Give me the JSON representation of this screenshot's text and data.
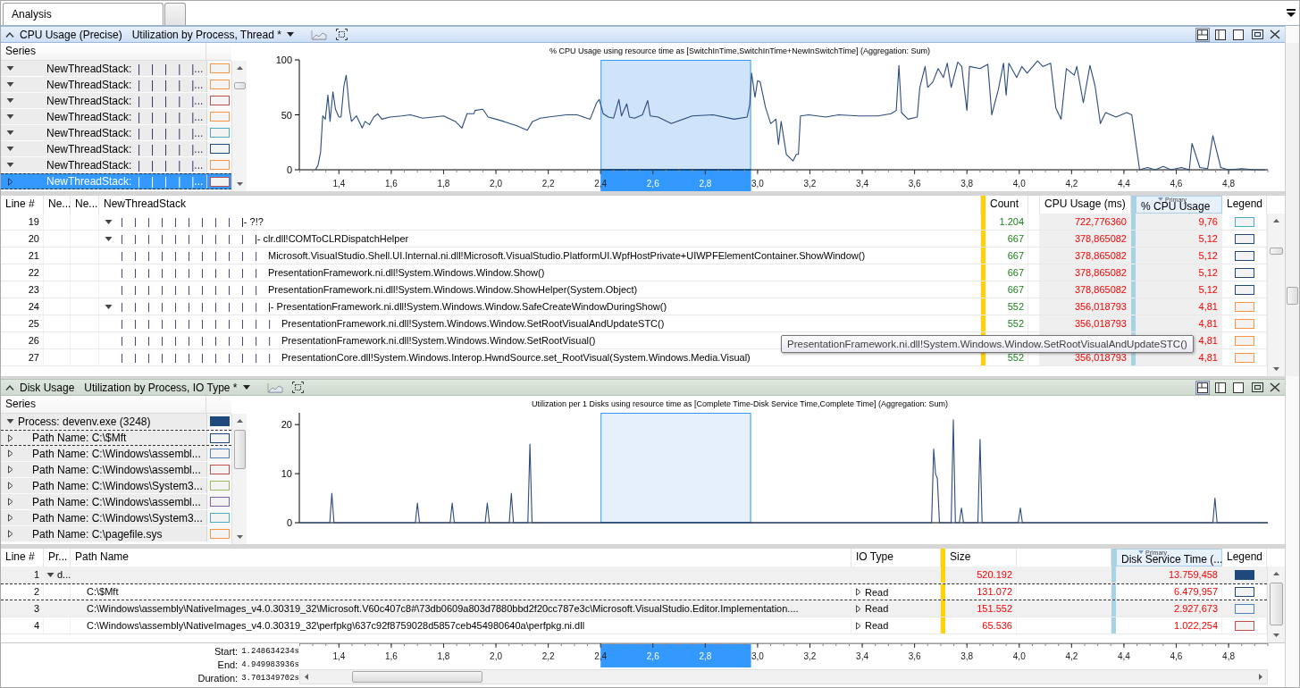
{
  "tabs": [
    {
      "label": "Analysis",
      "selected": true
    },
    {
      "selected": false
    }
  ],
  "panels": [
    {
      "kind": "cpu",
      "active": true,
      "title": "CPU Usage (Precise)",
      "preset": "Utilization by Process, Thread *",
      "view_modes": [
        {
          "kind": "split",
          "selected": true
        },
        {
          "kind": "table",
          "selected": false
        },
        {
          "kind": "graph",
          "selected": false
        }
      ],
      "series_header": "Series",
      "series": [
        {
          "label": "NewThreadStack:",
          "tree": "| | | | |...",
          "expanded": true,
          "selected": false,
          "focused": false,
          "filled": false,
          "color": "#f79646"
        },
        {
          "label": "NewThreadStack:",
          "tree": "| | | | |...",
          "expanded": true,
          "selected": false,
          "focused": false,
          "filled": false,
          "color": "#f79646"
        },
        {
          "label": "NewThreadStack:",
          "tree": "| | | | |...",
          "expanded": true,
          "selected": false,
          "focused": false,
          "filled": false,
          "color": "#c0504d"
        },
        {
          "label": "NewThreadStack:",
          "tree": "| | | | |...",
          "expanded": true,
          "selected": false,
          "focused": false,
          "filled": false,
          "color": "#f79646"
        },
        {
          "label": "NewThreadStack:",
          "tree": "| | | | |...",
          "expanded": true,
          "selected": false,
          "focused": false,
          "filled": false,
          "color": "#4bacc6"
        },
        {
          "label": "NewThreadStack:",
          "tree": "| | | | |...",
          "expanded": true,
          "selected": false,
          "focused": false,
          "filled": false,
          "color": "#1f497d"
        },
        {
          "label": "NewThreadStack:",
          "tree": "| | | | |...",
          "expanded": true,
          "selected": false,
          "focused": false,
          "filled": false,
          "color": "#f79646"
        },
        {
          "label": "NewThreadStack:",
          "tree": "| | | | |...",
          "expanded": false,
          "selected": true,
          "focused": true,
          "filled": false,
          "color": "#c0504d"
        }
      ],
      "chart_data": {
        "type": "line",
        "title": "% CPU Usage using resource time as [SwitchInTime,SwitchInTime+NewInSwitchTime] (Aggregation: Sum)",
        "x": [
          1.31,
          1.32,
          1.33,
          1.338,
          1.348,
          1.358,
          1.366,
          1.377,
          1.387,
          1.4,
          1.408,
          1.419,
          1.428,
          1.44,
          1.448,
          1.467,
          1.489,
          1.5,
          1.517,
          1.533,
          1.548,
          1.564,
          1.595,
          1.64,
          1.673,
          1.72,
          1.8,
          1.845,
          1.87,
          1.89,
          1.916,
          1.92,
          1.95,
          1.97,
          2.0,
          2.03,
          2.08,
          2.12,
          2.14,
          2.17,
          2.2,
          2.27,
          2.31,
          2.36,
          2.385,
          2.395,
          2.41,
          2.43,
          2.45,
          2.47,
          2.48,
          2.5,
          2.51,
          2.53,
          2.56,
          2.58,
          2.59,
          2.62,
          2.67,
          2.75,
          2.83,
          2.91,
          2.96,
          2.97,
          2.977,
          2.99,
          3.0,
          3.01,
          3.03,
          3.05,
          3.07,
          3.08,
          3.09,
          3.11,
          3.135,
          3.148,
          3.156,
          3.164,
          3.196,
          3.26,
          3.31,
          3.385,
          3.46,
          3.51,
          3.53,
          3.54,
          3.55,
          3.575,
          3.61,
          3.62,
          3.64,
          3.65,
          3.67,
          3.69,
          3.71,
          3.725,
          3.74,
          3.765,
          3.78,
          3.8,
          3.81,
          3.85,
          3.88,
          3.895,
          3.92,
          3.94,
          3.95,
          3.96,
          3.99,
          4.01,
          4.03,
          4.07,
          4.09,
          4.12,
          4.14,
          4.16,
          4.18,
          4.21,
          4.22,
          4.245,
          4.27,
          4.29,
          4.31,
          4.33,
          4.37,
          4.41,
          4.43,
          4.46,
          4.49,
          4.52,
          4.55,
          4.58,
          4.62,
          4.65,
          4.66,
          4.69,
          4.72,
          4.74,
          4.77,
          4.8,
          4.85,
          4.9,
          4.94
        ],
        "series": [
          {
            "color": "#2b4c7e",
            "values": [
              0,
              4,
              16,
              49,
              46,
              68,
              44,
              71,
              55,
              48,
              48,
              76,
              86,
              55,
              44,
              49,
              38,
              44,
              41,
              48,
              51,
              46,
              48,
              49,
              50,
              47,
              49,
              44,
              38,
              51,
              51,
              54,
              55,
              48,
              46,
              44,
              40,
              36,
              44,
              47,
              48,
              50,
              50,
              46,
              61,
              64,
              51,
              48,
              47,
              64,
              49,
              60,
              48,
              47,
              50,
              63,
              49,
              48,
              42,
              49,
              50,
              46,
              48,
              59,
              88,
              66,
              81,
              80,
              57,
              42,
              46,
              23,
              44,
              14,
              8,
              14,
              14,
              49,
              50,
              48,
              50,
              49,
              49,
              51,
              54,
              95,
              52,
              46,
              48,
              75,
              94,
              75,
              80,
              92,
              84,
              97,
              75,
              98,
              94,
              54,
              94,
              92,
              96,
              50,
              73,
              97,
              68,
              97,
              84,
              94,
              88,
              99,
              94,
              97,
              56,
              46,
              92,
              86,
              94,
              61,
              95,
              76,
              42,
              52,
              48,
              52,
              50,
              0,
              2,
              0,
              3,
              0,
              2,
              0,
              24,
              2,
              1,
              31,
              2,
              0,
              1,
              0,
              0
            ]
          }
        ],
        "xlim": [
          1.2486,
          4.95
        ],
        "ylim": [
          0,
          100
        ],
        "xticks": [
          {
            "value": 1.4,
            "label": "1,4"
          },
          {
            "value": 1.6,
            "label": "1,6"
          },
          {
            "value": 1.8,
            "label": "1,8"
          },
          {
            "value": 2.0,
            "label": "2,0"
          },
          {
            "value": 2.2,
            "label": "2,2"
          },
          {
            "value": 2.4,
            "label": "2,4"
          },
          {
            "value": 2.6,
            "label": "2,6"
          },
          {
            "value": 2.8,
            "label": "2,8"
          },
          {
            "value": 3.0,
            "label": "3,0"
          },
          {
            "value": 3.2,
            "label": "3,2"
          },
          {
            "value": 3.4,
            "label": "3,4"
          },
          {
            "value": 3.6,
            "label": "3,6"
          },
          {
            "value": 3.8,
            "label": "3,8"
          },
          {
            "value": 4.0,
            "label": "4,0"
          },
          {
            "value": 4.2,
            "label": "4,2"
          },
          {
            "value": 4.4,
            "label": "4,4"
          },
          {
            "value": 4.6,
            "label": "4,6"
          },
          {
            "value": 4.8,
            "label": "4,8"
          }
        ],
        "yticks": [
          0,
          50,
          100
        ],
        "bands": [
          {
            "axis": "x",
            "from": 2.4,
            "to": 2.975
          }
        ]
      },
      "table": {
        "columns": [
          {
            "kind": "text",
            "label": "Line #",
            "sorted": false
          },
          {
            "kind": "text",
            "label": "Ne...",
            "sorted": false
          },
          {
            "kind": "text",
            "label": "Ne...",
            "sorted": false
          },
          {
            "kind": "text",
            "label": "NewThreadStack",
            "sorted": false
          },
          {
            "kind": "divider",
            "color": "#ffd200"
          },
          {
            "kind": "text",
            "label": "Count",
            "sorted": false
          },
          {
            "kind": "blank"
          },
          {
            "kind": "text",
            "label": "CPU Usage (ms)",
            "sorted": false
          },
          {
            "kind": "divider",
            "color": "#a9d3e5"
          },
          {
            "kind": "text",
            "label": "% CPU Usage",
            "badge": "Primary",
            "sorted": true
          },
          {
            "kind": "text",
            "label": "Legend",
            "sorted": false
          }
        ],
        "rows": [
          {
            "line": "19",
            "kind": "branch",
            "expanded": true,
            "tree": "| | | | | | | | |",
            "name": "|- ?!?",
            "count": "1.204",
            "cpu": "722,776360",
            "percent": "9,76",
            "color": "#4bacc6"
          },
          {
            "line": "20",
            "kind": "branch",
            "expanded": true,
            "tree": "| | | | | | | | | |",
            "name": "|- clr.dll!COMToCLRDispatchHelper",
            "count": "667",
            "cpu": "378,865082",
            "percent": "5,12",
            "color": "#1f497d"
          },
          {
            "line": "21",
            "kind": "leaf",
            "tree": "| | | | | | | | | | |",
            "name": "Microsoft.VisualStudio.Shell.UI.Internal.ni.dll!Microsoft.VisualStudio.PlatformUI.WpfHostPrivate+UIWPFElementContainer.ShowWindow()",
            "count": "667",
            "cpu": "378,865082",
            "percent": "5,12",
            "color": "#1f497d"
          },
          {
            "line": "22",
            "kind": "leaf",
            "tree": "| | | | | | | | | | |",
            "name": "PresentationFramework.ni.dll!System.Windows.Window.Show()",
            "count": "667",
            "cpu": "378,865082",
            "percent": "5,12",
            "color": "#1f497d"
          },
          {
            "line": "23",
            "kind": "leaf",
            "tree": "| | | | | | | | | | |",
            "name": "PresentationFramework.ni.dll!System.Windows.Window.ShowHelper(System.Object)",
            "count": "667",
            "cpu": "378,865082",
            "percent": "5,12",
            "color": "#1f497d"
          },
          {
            "line": "24",
            "kind": "branch",
            "expanded": true,
            "tree": "| | | | | | | | | | |",
            "name": "|- PresentationFramework.ni.dll!System.Windows.Window.SafeCreateWindowDuringShow()",
            "count": "552",
            "cpu": "356,018793",
            "percent": "4,81",
            "color": "#f79646"
          },
          {
            "line": "25",
            "kind": "leaf",
            "tree": "| | | | | | | | | | | |",
            "name": "PresentationFramework.ni.dll!System.Windows.Window.SetRootVisualAndUpdateSTC()",
            "count": "552",
            "cpu": "356,018793",
            "percent": "4,81",
            "color": "#f79646"
          },
          {
            "line": "26",
            "kind": "leaf",
            "tree": "| | | | | | | | | | | |",
            "name": "PresentationFramework.ni.dll!System.Windows.Window.SetRootVisual()",
            "percent": "4,81",
            "color": "#f79646"
          },
          {
            "line": "27",
            "kind": "leaf",
            "tree": "| | | | | | | | | | | |",
            "name": "PresentationCore.dll!System.Windows.Interop.HwndSource.set_RootVisual(System.Windows.Media.Visual)",
            "count": "552",
            "cpu": "356,018793",
            "percent": "4,81",
            "color": "#f79646"
          }
        ]
      },
      "tooltip": "PresentationFramework.ni.dll!System.Windows.Window.SetRootVisualAndUpdateSTC()"
    },
    {
      "kind": "disk",
      "active": false,
      "title": "Disk Usage",
      "preset": "Utilization by Process, IO Type *",
      "view_modes": [
        {
          "kind": "split",
          "selected": true
        },
        {
          "kind": "table",
          "selected": false
        },
        {
          "kind": "graph",
          "selected": false
        }
      ],
      "series_header": "Series",
      "series": [
        {
          "label": "Process: devenv.exe (3248)",
          "expanded": true,
          "selected": false,
          "focused": false,
          "filled": true,
          "color": "#1f497d",
          "children": [
            {
              "label": "Path Name: C:\\$Mft",
              "expanded": false,
              "selected": false,
              "focused": true,
              "filled": false,
              "color": "#1f497d"
            },
            {
              "label": "Path Name: C:\\Windows\\assembl...",
              "expanded": false,
              "selected": false,
              "focused": false,
              "filled": false,
              "color": "#4f81bd"
            },
            {
              "label": "Path Name: C:\\Windows\\assembl...",
              "expanded": false,
              "selected": false,
              "focused": false,
              "filled": false,
              "color": "#c0504d"
            },
            {
              "label": "Path Name: C:\\Windows\\System3...",
              "expanded": false,
              "selected": false,
              "focused": false,
              "filled": false,
              "color": "#9bbb59"
            },
            {
              "label": "Path Name: C:\\Windows\\assembl...",
              "expanded": false,
              "selected": false,
              "focused": false,
              "filled": false,
              "color": "#8064a2"
            },
            {
              "label": "Path Name: C:\\Windows\\System3...",
              "expanded": false,
              "selected": false,
              "focused": false,
              "filled": false,
              "color": "#4bacc6"
            },
            {
              "label": "Path Name: C:\\pagefile.sys",
              "expanded": false,
              "selected": false,
              "focused": false,
              "filled": false,
              "color": "#f79646"
            }
          ]
        }
      ],
      "chart_data": {
        "type": "line",
        "title": "Utilization per 1 Disks using resource time as [Complete Time-Disk Service Time,Complete Time] (Aggregation: Sum)",
        "x": [
          1.25,
          1.365,
          1.373,
          1.381,
          1.692,
          1.7,
          1.708,
          1.825,
          1.833,
          1.841,
          1.959,
          1.967,
          1.975,
          2.051,
          2.059,
          2.067,
          2.122,
          2.13,
          2.138,
          3.665,
          3.673,
          3.68,
          3.687,
          3.695,
          3.74,
          3.748,
          3.756,
          3.771,
          3.779,
          3.787,
          3.842,
          3.85,
          3.858,
          3.996,
          4.004,
          4.012,
          4.74,
          4.748,
          4.756,
          4.95
        ],
        "series": [
          {
            "color": "#2b4c7e",
            "values": [
              0,
              0,
              6,
              0,
              0,
              4,
              0,
              0,
              4,
              0,
              0,
              4,
              0,
              0,
              6,
              0,
              0,
              16,
              0,
              0,
              15,
              10,
              9,
              0,
              0,
              21,
              0,
              0,
              3,
              0,
              0,
              17,
              0,
              0,
              3,
              0,
              0,
              5,
              0,
              0
            ]
          }
        ],
        "xlim": [
          1.2486,
          4.95
        ],
        "ylim": [
          0,
          22.4
        ],
        "yticks": [
          0,
          10,
          20
        ],
        "bands": [
          {
            "axis": "x",
            "from": 2.4,
            "to": 2.975
          }
        ]
      },
      "table": {
        "columns": [
          {
            "kind": "text",
            "label": "Line #",
            "sorted": false
          },
          {
            "kind": "text",
            "label": "Pr...",
            "sorted": false
          },
          {
            "kind": "text",
            "label": "Path Name",
            "sorted": false
          },
          {
            "kind": "text",
            "label": "IO Type",
            "sorted": false
          },
          {
            "kind": "divider",
            "color": "#ffd200"
          },
          {
            "kind": "text",
            "label": "Size",
            "sorted": false
          },
          {
            "kind": "blank"
          },
          {
            "kind": "divider",
            "color": "#a9d3e5"
          },
          {
            "kind": "text",
            "label": "Disk Service Time (...",
            "badge": "Primary",
            "sorted": true
          },
          {
            "kind": "text",
            "label": "Legend",
            "sorted": false
          }
        ],
        "rows": [
          {
            "line": "1",
            "process": "d...",
            "expanded": true,
            "size": "520.192",
            "time": "13.759,458",
            "color": "#1f497d",
            "filled": true,
            "focused": false
          },
          {
            "line": "2",
            "path": "C:\\$Mft",
            "io_type": "Read",
            "expanded": false,
            "size": "131.072",
            "time": "6.479,957",
            "color": "#1f497d",
            "filled": false,
            "focused": true
          },
          {
            "line": "3",
            "path": "C:\\Windows\\assembly\\NativeImages_v4.0.30319_32\\Microsoft.V60c407c8#\\73db0609a803d7880bbd2f20cc787e3c\\Microsoft.VisualStudio.Editor.Implementation....",
            "io_type": "Read",
            "expanded": false,
            "size": "151.552",
            "time": "2.927,673",
            "color": "#4f81bd",
            "filled": false,
            "focused": false
          },
          {
            "line": "4",
            "path": "C:\\Windows\\assembly\\NativeImages_v4.0.30319_32\\perfpkg\\637c92f8759028d5857ceb454980640a\\perfpkg.ni.dll",
            "io_type": "Read",
            "expanded": false,
            "size": "65.536",
            "time": "1.022,254",
            "color": "#c0504d",
            "filled": false,
            "focused": false
          }
        ]
      }
    }
  ],
  "timeline": {
    "fields": [
      {
        "label": "Start:",
        "value": "1.248634234s"
      },
      {
        "label": "End:",
        "value": "4.949983936s"
      },
      {
        "label": "Duration:",
        "value": "3.701349702s"
      }
    ],
    "ticks": [
      {
        "label": "1,4",
        "selected": false
      },
      {
        "label": "1,6",
        "selected": false
      },
      {
        "label": "1,8",
        "selected": false
      },
      {
        "label": "2,0",
        "selected": false
      },
      {
        "label": "2,2",
        "selected": false
      },
      {
        "label": "2,4",
        "selected": false
      },
      {
        "label": "2,6",
        "selected": true
      },
      {
        "label": "2,8",
        "selected": true
      },
      {
        "label": "3,0",
        "selected": false
      },
      {
        "label": "3,2",
        "selected": false
      },
      {
        "label": "3,4",
        "selected": false
      },
      {
        "label": "3,6",
        "selected": false
      },
      {
        "label": "3,8",
        "selected": false
      },
      {
        "label": "4,0",
        "selected": false
      },
      {
        "label": "4,2",
        "selected": false
      },
      {
        "label": "4,4",
        "selected": false
      },
      {
        "label": "4,6",
        "selected": false
      },
      {
        "label": "4,8",
        "selected": false
      }
    ]
  }
}
